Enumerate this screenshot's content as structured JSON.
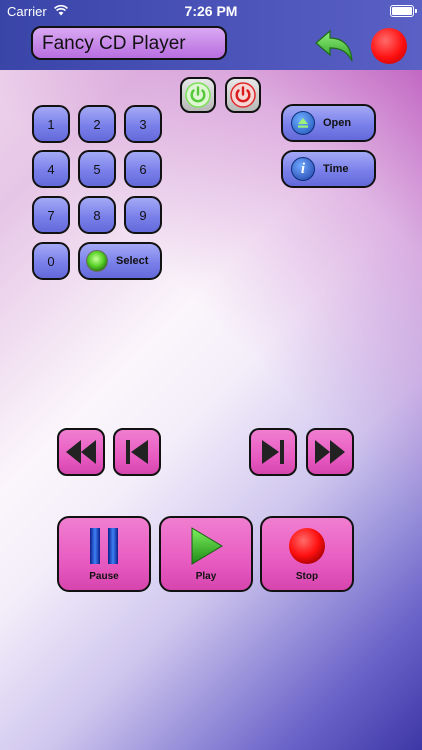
{
  "status": {
    "carrier": "Carrier",
    "time": "7:26 PM"
  },
  "header": {
    "title": "Fancy CD Player"
  },
  "keypad": {
    "keys": [
      "1",
      "2",
      "3",
      "4",
      "5",
      "6",
      "7",
      "8",
      "9",
      "0"
    ],
    "select_label": "Select"
  },
  "side": {
    "open_label": "Open",
    "time_label": "Time"
  },
  "transport": {
    "pause_label": "Pause",
    "play_label": "Play",
    "stop_label": "Stop"
  },
  "colors": {
    "header": "#3a45a8",
    "keypad": "#7a80ea",
    "transport": "#e85cc2",
    "record": "#ff1010",
    "power_on": "#7ee05a",
    "power_off": "#e02a2a"
  }
}
